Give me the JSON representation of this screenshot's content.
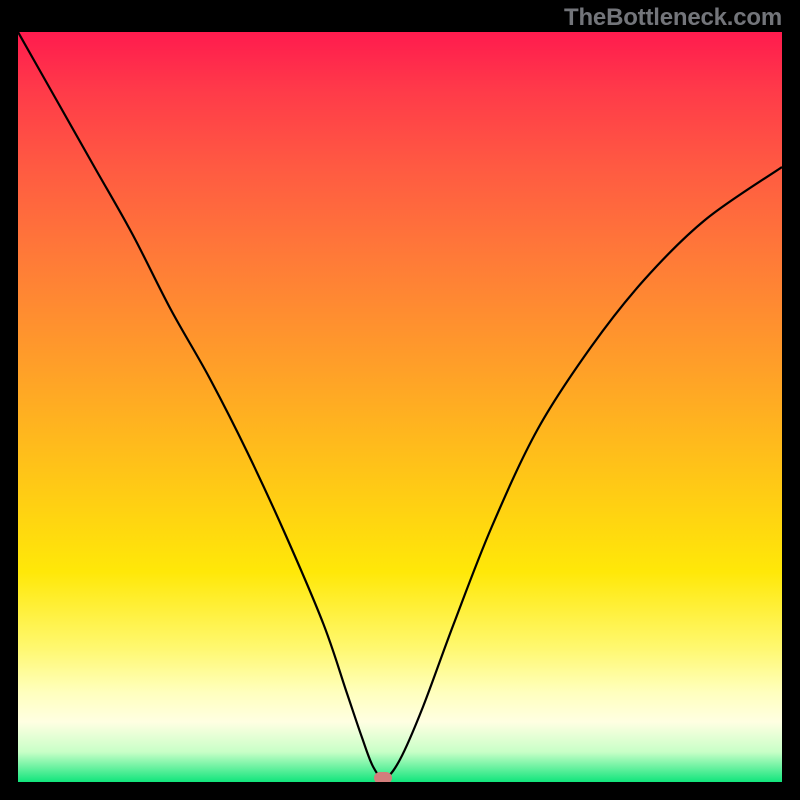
{
  "watermark": "TheBottleneck.com",
  "chart_data": {
    "type": "line",
    "title": "",
    "xlabel": "",
    "ylabel": "",
    "xlim": [
      0,
      100
    ],
    "ylim": [
      0,
      100
    ],
    "series": [
      {
        "name": "curve",
        "x": [
          0,
          5,
          10,
          15,
          20,
          25,
          30,
          35,
          40,
          43,
          45,
          46.5,
          48,
          50,
          53,
          57,
          62,
          68,
          75,
          82,
          90,
          100
        ],
        "y": [
          100,
          91,
          82,
          73,
          63,
          54,
          44,
          33,
          21,
          12,
          6,
          2,
          0.5,
          3,
          10,
          21,
          34,
          47,
          58,
          67,
          75,
          82
        ]
      }
    ],
    "background_gradient": {
      "top": "#ff1b4e",
      "mid": "#ffe808",
      "bottom_band": "#11e57c"
    },
    "marker": {
      "x": 47.8,
      "y": 0.5,
      "color": "#d37e7c"
    }
  }
}
